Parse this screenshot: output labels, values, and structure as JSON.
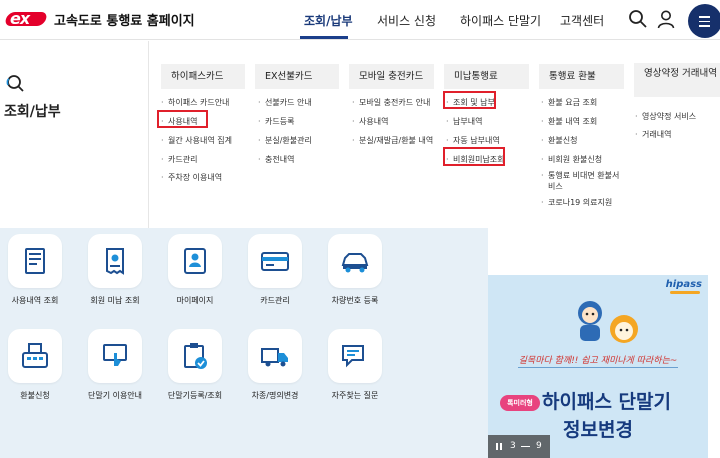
{
  "header": {
    "site_title": "고속도로 통행료 홈페이지",
    "nav": [
      "조회/납부",
      "서비스 신청",
      "하이패스 단말기",
      "고객센터"
    ],
    "active_nav": "조회/납부",
    "icons": [
      "search-icon",
      "user-icon",
      "menu-icon"
    ],
    "colors": {
      "brand_red": "#e4002b",
      "navy": "#16306b"
    }
  },
  "breadcrumb": {
    "title": "조회/납부",
    "icon": "search-icon"
  },
  "mega_menu": {
    "columns": [
      {
        "title": "하이패스카드",
        "items": [
          "하이패스 카드안내",
          "사용내역",
          "월간 사용내역 집계",
          "카드관리",
          "주차장 이용내역"
        ]
      },
      {
        "title": "EX선불카드",
        "items": [
          "선불카드 안내",
          "카드등록",
          "분실/환불관리",
          "충전내역"
        ]
      },
      {
        "title": "모바일 충전카드",
        "items": [
          "모바일 충전카드 안내",
          "사용내역",
          "분실/재발급/환불 내역"
        ]
      },
      {
        "title": "미납통행료",
        "items": [
          "조회 및 납부",
          "납부내역",
          "자동 납부내역",
          "비회원미납조회"
        ]
      },
      {
        "title": "통행료 환불",
        "items": [
          "환불 요금 조회",
          "환불 내역 조회",
          "환불신청",
          "비회원 환불신청",
          "통행료 비대면 환불서비스",
          "코로나19 의료지원"
        ]
      },
      {
        "title": "영상약정 거래내역",
        "items": [
          "영상약정 서비스",
          "거래내역"
        ]
      }
    ],
    "highlighted": [
      "사용내역",
      "조회 및 납부",
      "비회원미납조회"
    ]
  },
  "quick_menu": [
    {
      "label": "사용내역 조회",
      "icon": "document-list-icon"
    },
    {
      "label": "회원 미납 조회",
      "icon": "receipt-icon"
    },
    {
      "label": "마이페이지",
      "icon": "profile-card-icon"
    },
    {
      "label": "카드관리",
      "icon": "credit-card-icon"
    },
    {
      "label": "차량번호 등록",
      "icon": "car-icon"
    },
    {
      "label": "환불신청",
      "icon": "fax-icon"
    },
    {
      "label": "단말기 이용안내",
      "icon": "touch-screen-icon"
    },
    {
      "label": "단말기등록/조회",
      "icon": "clipboard-check-icon"
    },
    {
      "label": "차종/명의변경",
      "icon": "truck-icon"
    },
    {
      "label": "자주찾는 질문",
      "icon": "chat-bubble-icon"
    }
  ],
  "banner": {
    "brand": "hipass",
    "slogan": "길목마다 함께!! 쉽고 재미나게 따라하는~",
    "tag": "톡미러형",
    "title": "하이패스 단말기",
    "subtitle": "정보변경",
    "pager": {
      "current": "3",
      "total": "9"
    }
  }
}
